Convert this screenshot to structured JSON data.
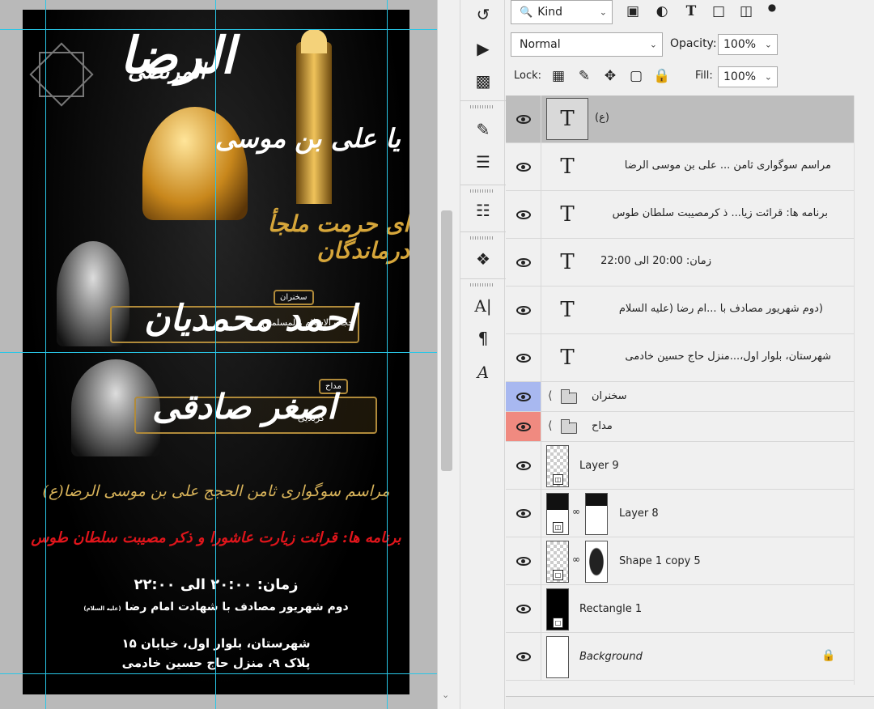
{
  "canvas": {
    "poster_texts": {
      "calligraphy_main": "الرضا",
      "calligraphy_morteza": "المرتضى",
      "calligraphy_musa": "یا علی بن موسی",
      "calligraphy_gold": "ای حرمت ملجأ درماندگان",
      "speaker_tag": "سخنران",
      "speaker_title": "حجت الاسلام والمسلمین",
      "speaker_name": "احمد محمدیان",
      "maddah_tag": "مداح",
      "maddah_title": "کربلایی",
      "maddah_name": "اصغر صادقی",
      "line_ceremony": "مراسم سوگواری ثامن الحجج علی بن موسی الرضا(ع)",
      "line_program": "برنامه ها: قرائت زیارت عاشورا و ذکر مصیبت سلطان طوس",
      "line_time": "زمان: ۲۰:۰۰ الی ۲۲:۰۰",
      "line_date": "دوم شهریور مصادف با شهادت امام رضا",
      "line_date_note": "(علیه السلام)",
      "line_address1": "شهرستان، بلوار اول، خیابان ۱۵",
      "line_address2": "پلاک ۹، منزل حاج حسین خادمی"
    }
  },
  "toolstrip": {
    "icons": [
      "history-icon",
      "play-action-icon",
      "clone-source-icon",
      "brush-settings-icon",
      "brush-presets-icon",
      "tool-presets-icon",
      "color-channels-icon",
      "character-icon",
      "paragraph-icon",
      "glyphs-icon"
    ]
  },
  "layers_panel": {
    "filter_kind": "Kind",
    "blend_mode": "Normal",
    "opacity_label": "Opacity:",
    "opacity_value": "100%",
    "lock_label": "Lock:",
    "fill_label": "Fill:",
    "fill_value": "100%",
    "layers": [
      {
        "name": "(ع)",
        "type": "text",
        "selected": true
      },
      {
        "name": "مراسم سوگواری ثامن ... علی بن موسی الرضا",
        "type": "text"
      },
      {
        "name": "برنامه ها: قرائت زیا... ذ کرمصیبت سلطان طوس",
        "type": "text"
      },
      {
        "name": "زمان: 20:00 الی 22:00",
        "type": "text"
      },
      {
        "name": "(دوم شهریور مصادف با ...ام رضا (علیه السلام",
        "type": "text"
      },
      {
        "name": "شهرستان، بلوار اول،...منزل حاج حسین خادمی",
        "type": "text"
      },
      {
        "name": "سخنران",
        "type": "group",
        "color": "#a8b8f0"
      },
      {
        "name": "مداح",
        "type": "group",
        "color": "#f08a80"
      },
      {
        "name": "Layer 9",
        "type": "smart"
      },
      {
        "name": "Layer 8",
        "type": "smart-mask"
      },
      {
        "name": "Shape 1 copy 5",
        "type": "shape-mask"
      },
      {
        "name": "Rectangle 1",
        "type": "shape"
      },
      {
        "name": "Background",
        "type": "background"
      }
    ]
  }
}
